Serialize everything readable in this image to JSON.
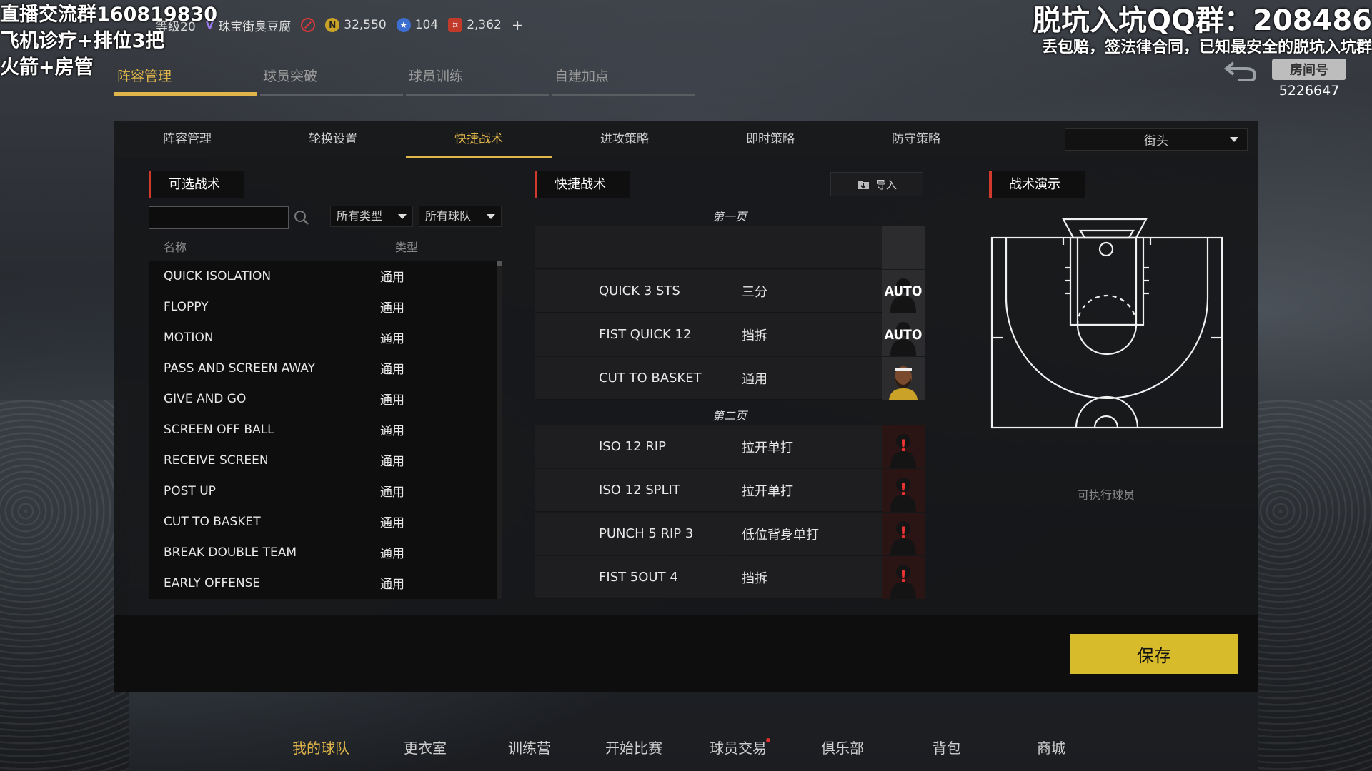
{
  "overlay": {
    "stream_lines": [
      "直播交流群160819830",
      "飞机诊疗+排位3把",
      "火箭+房管"
    ],
    "qq_line1": "脱坑入坑QQ群：208486",
    "qq_line2": "丢包赔，签法律合同，已知最安全的脱坑入坑群",
    "room_label": "房间号",
    "room_number": "5226647"
  },
  "topbar": {
    "level": "等级20",
    "team_name": "珠宝街臭豆腐",
    "coins": "32,550",
    "stars": "104",
    "rc": "2,362",
    "plus": "+"
  },
  "main_tabs": [
    "阵容管理",
    "球员突破",
    "球员训练",
    "自建加点"
  ],
  "sub_tabs": [
    "阵容管理",
    "轮换设置",
    "快捷战术",
    "进攻策略",
    "即时策略",
    "防守策略"
  ],
  "mode_dropdown": "街头",
  "left": {
    "header": "可选战术",
    "search_placeholder": "",
    "filter_type": "所有类型",
    "filter_team": "所有球队",
    "col_name": "名称",
    "col_type": "类型",
    "plays": [
      {
        "name": "QUICK ISOLATION",
        "type": "通用"
      },
      {
        "name": "FLOPPY",
        "type": "通用"
      },
      {
        "name": "MOTION",
        "type": "通用"
      },
      {
        "name": "PASS AND SCREEN AWAY",
        "type": "通用"
      },
      {
        "name": "GIVE AND GO",
        "type": "通用"
      },
      {
        "name": "SCREEN OFF BALL",
        "type": "通用"
      },
      {
        "name": "RECEIVE SCREEN",
        "type": "通用"
      },
      {
        "name": "POST UP",
        "type": "通用"
      },
      {
        "name": "CUT TO BASKET",
        "type": "通用"
      },
      {
        "name": "BREAK DOUBLE TEAM",
        "type": "通用"
      },
      {
        "name": "EARLY OFFENSE",
        "type": "通用"
      }
    ]
  },
  "middle": {
    "header": "快捷战术",
    "import_label": "导入",
    "page1_label": "第一页",
    "page2_label": "第二页",
    "page1": [
      {
        "name": "",
        "type": "",
        "slot": "empty"
      },
      {
        "name": "QUICK 3 STS",
        "type": "三分",
        "slot": "AUTO"
      },
      {
        "name": "FIST QUICK 12",
        "type": "挡拆",
        "slot": "AUTO"
      },
      {
        "name": "CUT TO BASKET",
        "type": "通用",
        "slot": "player"
      }
    ],
    "page2": [
      {
        "name": "ISO 12 RIP",
        "type": "拉开单打",
        "slot": "!"
      },
      {
        "name": "ISO 12 SPLIT",
        "type": "拉开单打",
        "slot": "!"
      },
      {
        "name": "PUNCH 5 RIP 3",
        "type": "低位背身单打",
        "slot": "!"
      },
      {
        "name": "FIST 5OUT 4",
        "type": "挡拆",
        "slot": "!"
      }
    ]
  },
  "right": {
    "header": "战术演示",
    "exec_label": "可执行球员"
  },
  "save_label": "保存",
  "bottom_nav": [
    "我的球队",
    "更衣室",
    "训练营",
    "开始比赛",
    "球员交易",
    "俱乐部",
    "背包",
    "商城"
  ],
  "colors": {
    "accent": "#e0b64a",
    "save": "#d8bb2a",
    "warn": "#e33333",
    "section_marker": "#d0392b"
  }
}
